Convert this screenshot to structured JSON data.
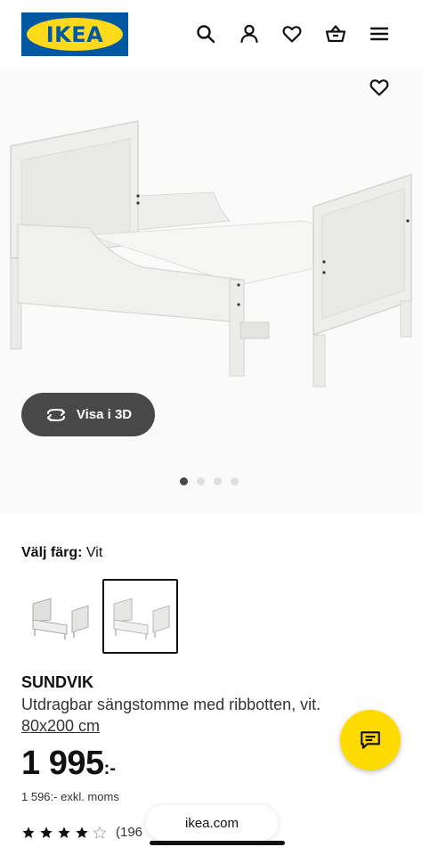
{
  "header": {
    "logo_text": "IKEA",
    "icons": [
      "search-icon",
      "user-icon",
      "heart-icon",
      "basket-icon",
      "menu-icon"
    ]
  },
  "gallery": {
    "view3d_label": "Visa i 3D",
    "dot_count": 4,
    "active_dot": 0
  },
  "color": {
    "label": "Välj färg:",
    "value": "Vit",
    "swatches": [
      "Vit",
      "Vit"
    ],
    "selected": 1
  },
  "product": {
    "name": "SUNDVIK",
    "description": "Utdragbar sängstomme med ribbotten, vit.",
    "size": "80x200 cm",
    "price": "1 995",
    "price_suffix": ":-",
    "price_ex_vat": "1 596:- exkl. moms",
    "rating_stars": 4,
    "rating_max": 5,
    "rating_count": "(196"
  },
  "browser": {
    "url": "ikea.com"
  },
  "colors": {
    "ikea_blue": "#0058a3",
    "ikea_yellow": "#ffda1a",
    "chat_yellow": "#ffdb00",
    "dark_button": "#484848"
  }
}
